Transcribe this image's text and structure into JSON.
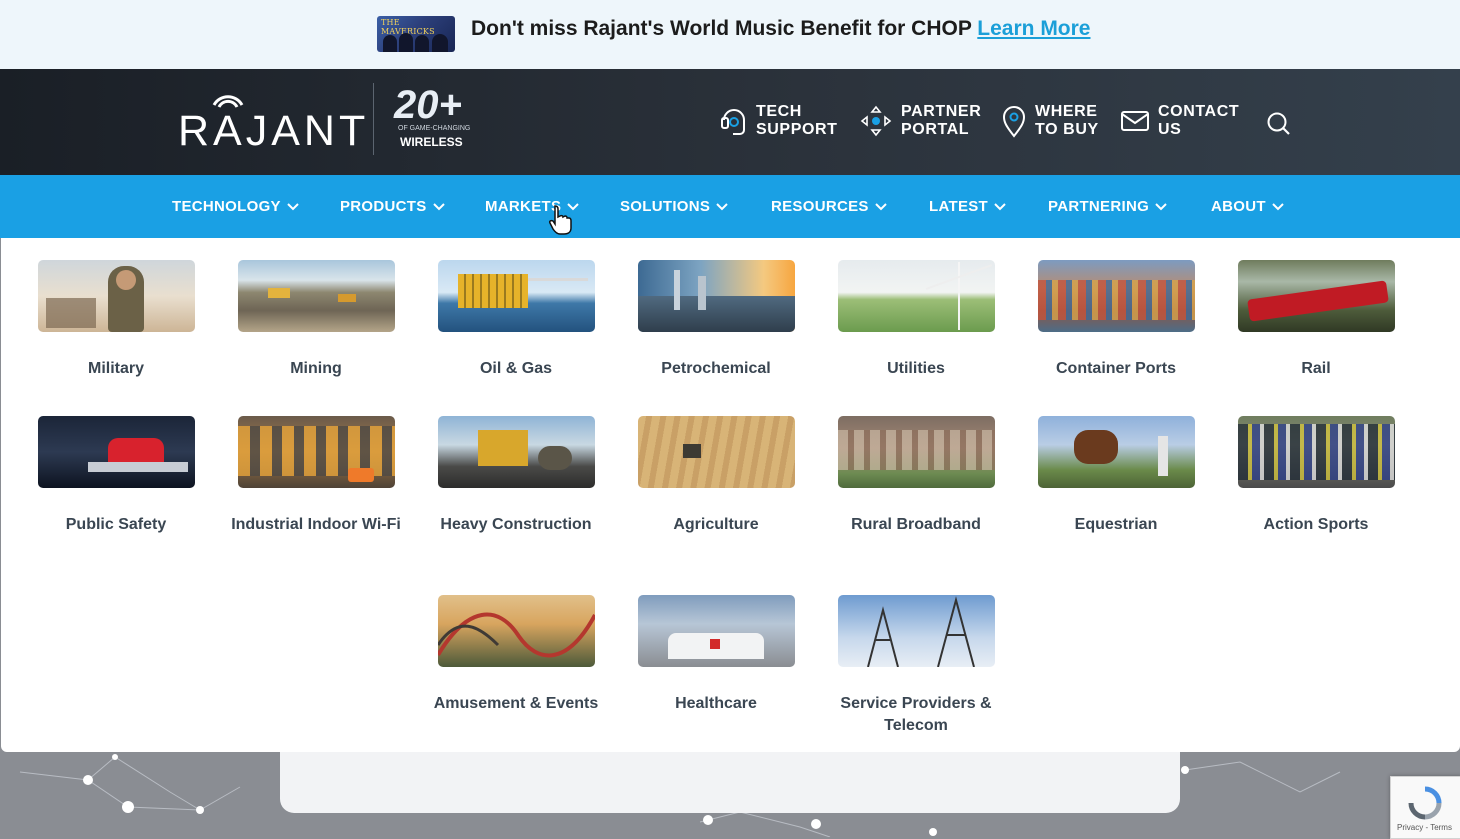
{
  "announcement": {
    "thumb_text": "THE MAVERICKS",
    "text": "Don't miss Rajant's World Music Benefit for CHOP",
    "link": "Learn More"
  },
  "header": {
    "logo": "RAJANT",
    "anniversary_number": "20+",
    "anniversary_sub": "OF GAME-CHANGING",
    "anniversary_word": "WIRELESS",
    "util_links": [
      {
        "label": "TECH SUPPORT",
        "icon": "headset-icon"
      },
      {
        "label": "PARTNER PORTAL",
        "icon": "portal-icon"
      },
      {
        "label": "WHERE TO BUY",
        "icon": "map-pin-icon"
      },
      {
        "label": "CONTACT US",
        "icon": "envelope-icon"
      }
    ],
    "search_icon": "search-icon"
  },
  "nav": {
    "items": [
      {
        "label": "TECHNOLOGY"
      },
      {
        "label": "PRODUCTS"
      },
      {
        "label": "MARKETS"
      },
      {
        "label": "SOLUTIONS"
      },
      {
        "label": "RESOURCES"
      },
      {
        "label": "LATEST"
      },
      {
        "label": "PARTNERING"
      },
      {
        "label": "ABOUT"
      }
    ]
  },
  "markets": [
    {
      "label": "Military"
    },
    {
      "label": "Mining"
    },
    {
      "label": "Oil & Gas"
    },
    {
      "label": "Petrochemical"
    },
    {
      "label": "Utilities"
    },
    {
      "label": "Container Ports"
    },
    {
      "label": "Rail"
    },
    {
      "label": "Public Safety"
    },
    {
      "label": "Industrial Indoor Wi-Fi"
    },
    {
      "label": "Heavy Construction"
    },
    {
      "label": "Agriculture"
    },
    {
      "label": "Rural Broadband"
    },
    {
      "label": "Equestrian"
    },
    {
      "label": "Action Sports"
    },
    {
      "label": "Amusement & Events"
    },
    {
      "label": "Healthcare"
    },
    {
      "label": "Service Providers & Telecom"
    }
  ],
  "recaptcha": {
    "text": "Privacy - Terms"
  },
  "colors": {
    "nav_blue": "#1aa0e4",
    "link_blue": "#1b9fd8",
    "header_dark": "#1a1f26"
  }
}
